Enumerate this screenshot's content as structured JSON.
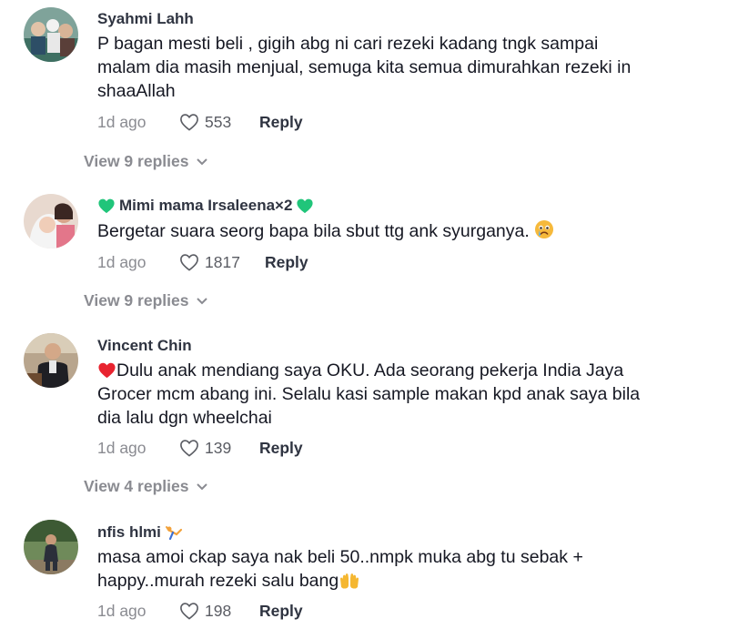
{
  "comments": [
    {
      "username": "Syahmi Lahh",
      "text_lines": [
        "P bagan mesti beli , gigih abg ni cari rezeki kadang tngk sampai",
        "malam dia masih menjual, semuga kita semua dimurahkan rezeki in",
        "shaaAllah"
      ],
      "time": "1d ago",
      "likes": "553",
      "reply_label": "Reply",
      "view_replies": "View 9 replies"
    },
    {
      "username": "Mimi mama Irsaleena×2",
      "text_lines": [
        "Bergetar suara seorg bapa bila sbut ttg ank syurganya."
      ],
      "time": "1d ago",
      "likes": "1817",
      "reply_label": "Reply",
      "view_replies": "View 9 replies"
    },
    {
      "username": "Vincent Chin",
      "text_lines": [
        "Dulu anak mendiang saya OKU. Ada seorang pekerja India Jaya",
        "Grocer mcm abang ini. Selalu kasi sample makan kpd anak saya bila",
        "dia lalu dgn wheelchai"
      ],
      "time": "1d ago",
      "likes": "139",
      "reply_label": "Reply",
      "view_replies": "View 4 replies"
    },
    {
      "username": "nfis hlmi",
      "text_lines": [
        "masa amoi ckap saya nak beli 50..nmpk muka abg tu sebak +",
        "happy..murah rezeki salu bang"
      ],
      "time": "1d ago",
      "likes": "198",
      "reply_label": "Reply"
    }
  ],
  "colors": {
    "text": "#161823",
    "muted": "#8a8b91",
    "username": "#2f3441",
    "green_heart": "#20c57a",
    "red_heart": "#e8232f"
  },
  "icons": {
    "like": "heart-outline-icon",
    "expand": "chevron-down-icon",
    "username_decoration": "green-heart-icon",
    "crying_emoji": "crying-face-icon",
    "red_heart": "red-heart-icon",
    "clapping": "clapping-hands-icon",
    "gymnast": "gymnast-icon"
  }
}
